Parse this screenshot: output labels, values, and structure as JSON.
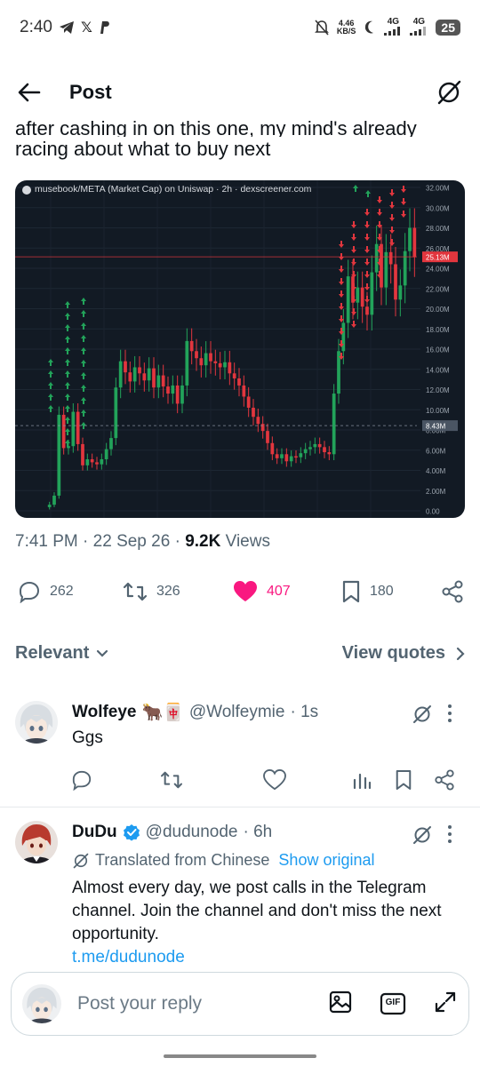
{
  "status_bar": {
    "time": "2:40",
    "net_speed_top": "4.46",
    "net_speed_bottom": "KB/S",
    "signal1": "4G",
    "signal2": "4G",
    "battery": "25"
  },
  "topbar": {
    "title": "Post",
    "back_icon": "back-arrow-icon",
    "grok_icon": "grok-icon"
  },
  "post": {
    "cut_line": "after cashing in on this one, my mind's already",
    "text_line": "racing about what to buy next",
    "chart_caption": "musebook/META (Market Cap) on Uniswap · 2h · dexscreener.com",
    "time": "7:41 PM",
    "date": "22 Sep 26",
    "views_count": "9.2K",
    "views_label": "Views"
  },
  "chart_data": {
    "type": "candlestick",
    "title": "musebook/META (Market Cap) on Uniswap · 2h · dexscreener.com",
    "y_tick_labels": [
      "32.00M",
      "30.00M",
      "28.00M",
      "26.00M",
      "24.00M",
      "22.00M",
      "20.00M",
      "18.00M",
      "16.00M",
      "14.00M",
      "12.00M",
      "10.00M",
      "8.00M",
      "6.00M",
      "4.00M",
      "2.00M",
      "0.00"
    ],
    "ylim_millions": [
      0,
      32
    ],
    "price_labels": [
      {
        "text": "25.13M",
        "value": 25.13,
        "color": "#e2363e"
      },
      {
        "text": "8.43M",
        "value": 8.43,
        "color": "#4a5563"
      }
    ],
    "candles_close_millions": [
      0.6,
      1.5,
      9.5,
      6.2,
      6.4,
      9.8,
      6.6,
      4.5,
      5.1,
      4.8,
      4.6,
      5.1,
      6.1,
      7.2,
      12.2,
      14.8,
      13.7,
      12.8,
      14.2,
      13.6,
      12.9,
      14.1,
      12.2,
      13.4,
      12.3,
      11.6,
      12.4,
      10.6,
      12.4,
      16.8,
      15.8,
      15.1,
      14.4,
      15.6,
      14.8,
      14.6,
      14.2,
      14.7,
      13.6,
      13.1,
      12.4,
      11.3,
      10.2,
      9.3,
      8.6,
      7.9,
      6.7,
      5.6,
      5.2,
      5.6,
      4.9,
      5.4,
      5.3,
      5.7,
      6.1,
      6.3,
      6.6,
      6.3,
      5.8,
      5.6,
      11.6,
      15.8,
      18.6,
      23.2,
      20.6,
      22.1,
      20.2,
      19.4,
      23.6,
      26.4,
      22.1,
      25.6,
      24.4,
      20.9,
      22.3,
      25.7,
      28.0,
      25.1
    ],
    "markers": [
      {
        "type": "up-arrow",
        "color": "#22a35a"
      },
      {
        "type": "down-arrow",
        "color": "#e2363e"
      }
    ],
    "grid": true
  },
  "actions": {
    "replies": "262",
    "reposts": "326",
    "likes": "407",
    "bookmarks": "180"
  },
  "section": {
    "relevant": "Relevant",
    "view_quotes": "View quotes"
  },
  "replies": [
    {
      "name": "Wolfeye",
      "emoji": "🐂🀄",
      "handle": "@Wolfeymie",
      "time": "· 1s",
      "text": "Ggs"
    },
    {
      "name": "DuDu",
      "handle": "@dudunode",
      "time": "· 6h",
      "translated": "Translated from Chinese",
      "show_original": "Show original",
      "text": "Almost every day, we post calls in the Telegram channel. Join the channel and don't miss the next opportunity.",
      "link": "t.me/dudunode"
    }
  ],
  "reply_box": {
    "placeholder": "Post your reply",
    "gif_label": "GIF"
  },
  "colors": {
    "like": "#f91880",
    "link": "#1d9bf0",
    "muted": "#536471",
    "chart_bg": "#121a24",
    "up": "#22a35a",
    "down": "#e2363e"
  }
}
